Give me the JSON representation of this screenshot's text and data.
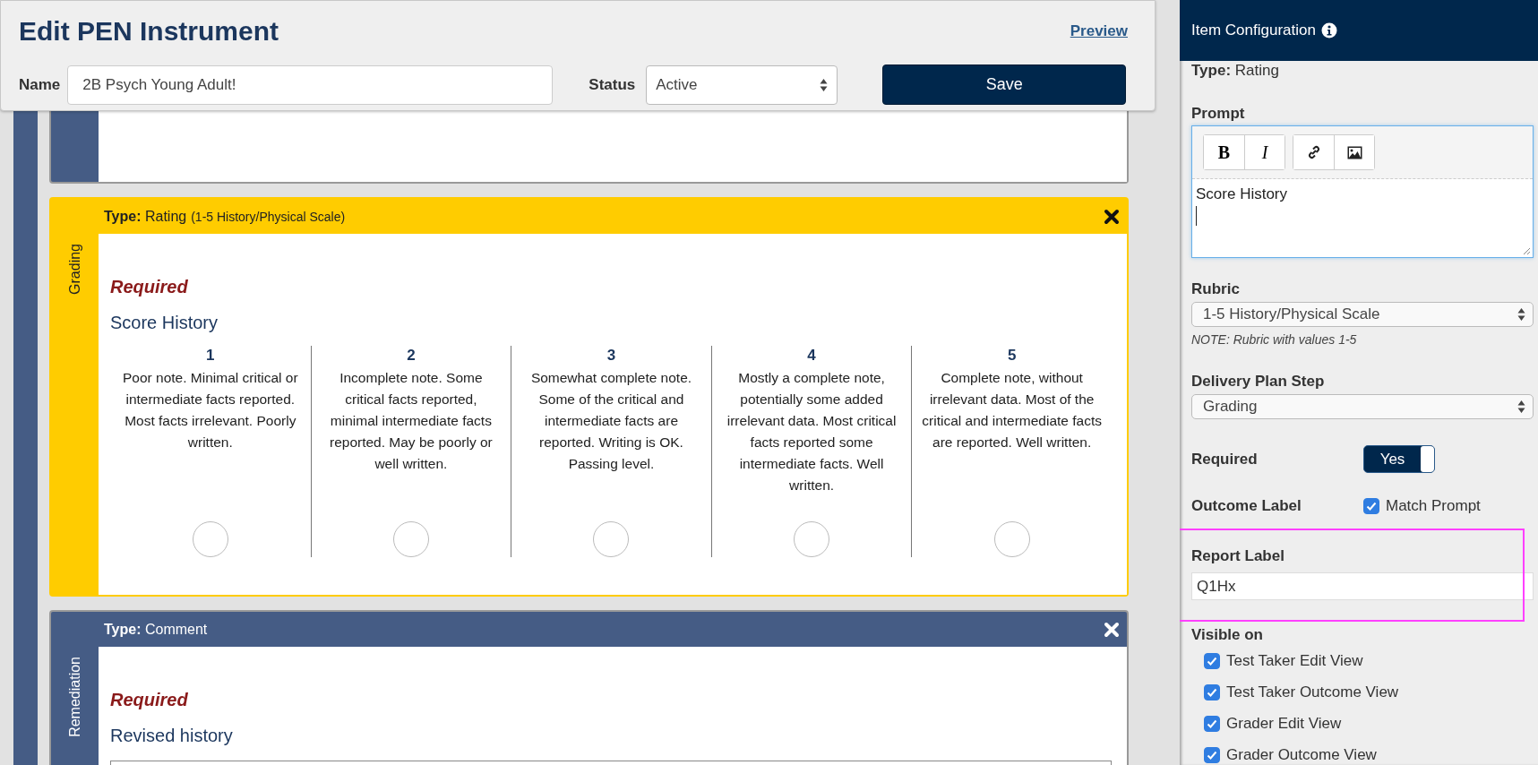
{
  "header": {
    "title": "Edit PEN Instrument",
    "preview_link": "Preview",
    "name": {
      "label": "Name",
      "value": "2B Psych Young Adult!"
    },
    "status": {
      "label": "Status",
      "value": "Active"
    },
    "save_button": "Save"
  },
  "items": [
    {
      "kind": "blank",
      "selected": false
    },
    {
      "kind": "rating",
      "selected": true,
      "step": "Grading",
      "type_label": "**Type:** Rating",
      "type_detail": "(1-5 History/Physical Scale)",
      "required": "Required",
      "prompt": "Score History",
      "options": [
        {
          "value": "1",
          "description": "Poor note. Minimal critical or intermediate facts reported. Most facts irrelevant. Poorly written.",
          "selected": false
        },
        {
          "value": "2",
          "description": "Incomplete note. Some critical facts reported, minimal intermediate facts reported. May be poorly or well written.",
          "selected": false
        },
        {
          "value": "3",
          "description": "Somewhat complete note. Some of the critical and intermediate facts are reported. Writing is OK. Passing level.",
          "selected": false
        },
        {
          "value": "4",
          "description": "Mostly a complete note, potentially some added irrelevant data. Most critical facts reported some intermediate facts. Well written.",
          "selected": false
        },
        {
          "value": "5",
          "description": "Complete note, without irrelevant data. Most of the critical and intermediate facts are reported. Well written.",
          "selected": false
        }
      ]
    },
    {
      "kind": "comment",
      "selected": false,
      "step": "Remediation",
      "type_label": "**Type:** Comment",
      "required": "Required",
      "prompt": "Revised history"
    }
  ],
  "config": {
    "title": "Item Configuration",
    "type_label": "**Type:** Rating",
    "prompt": {
      "label": "Prompt",
      "value": "Score History",
      "toolbar_groups": [
        [
          {
            "kind": "bold",
            "label": "B"
          },
          {
            "kind": "italic",
            "label": "I"
          }
        ],
        [
          {
            "kind": "link"
          },
          {
            "kind": "image"
          }
        ]
      ]
    },
    "rubric": {
      "label": "Rubric",
      "value": "1-5 History/Physical Scale",
      "note": "NOTE: Rubric with values 1-5"
    },
    "delivery_plan_step": {
      "label": "Delivery Plan Step",
      "value": "Grading"
    },
    "required": {
      "label": "Required",
      "toggle_text": "Yes",
      "on": true
    },
    "outcome_label": {
      "label": "Outcome Label",
      "match_prompt": {
        "label": "Match Prompt",
        "checked": true
      }
    },
    "report_label": {
      "label": "Report Label",
      "value": "Q1Hx",
      "highlighted": true
    },
    "visible_on": {
      "label": "Visible on",
      "options": [
        {
          "label": "Test Taker Edit View",
          "checked": true
        },
        {
          "label": "Test Taker Outcome View",
          "checked": true
        },
        {
          "label": "Grader Edit View",
          "checked": true
        },
        {
          "label": "Grader Outcome View",
          "checked": true
        }
      ]
    }
  }
}
